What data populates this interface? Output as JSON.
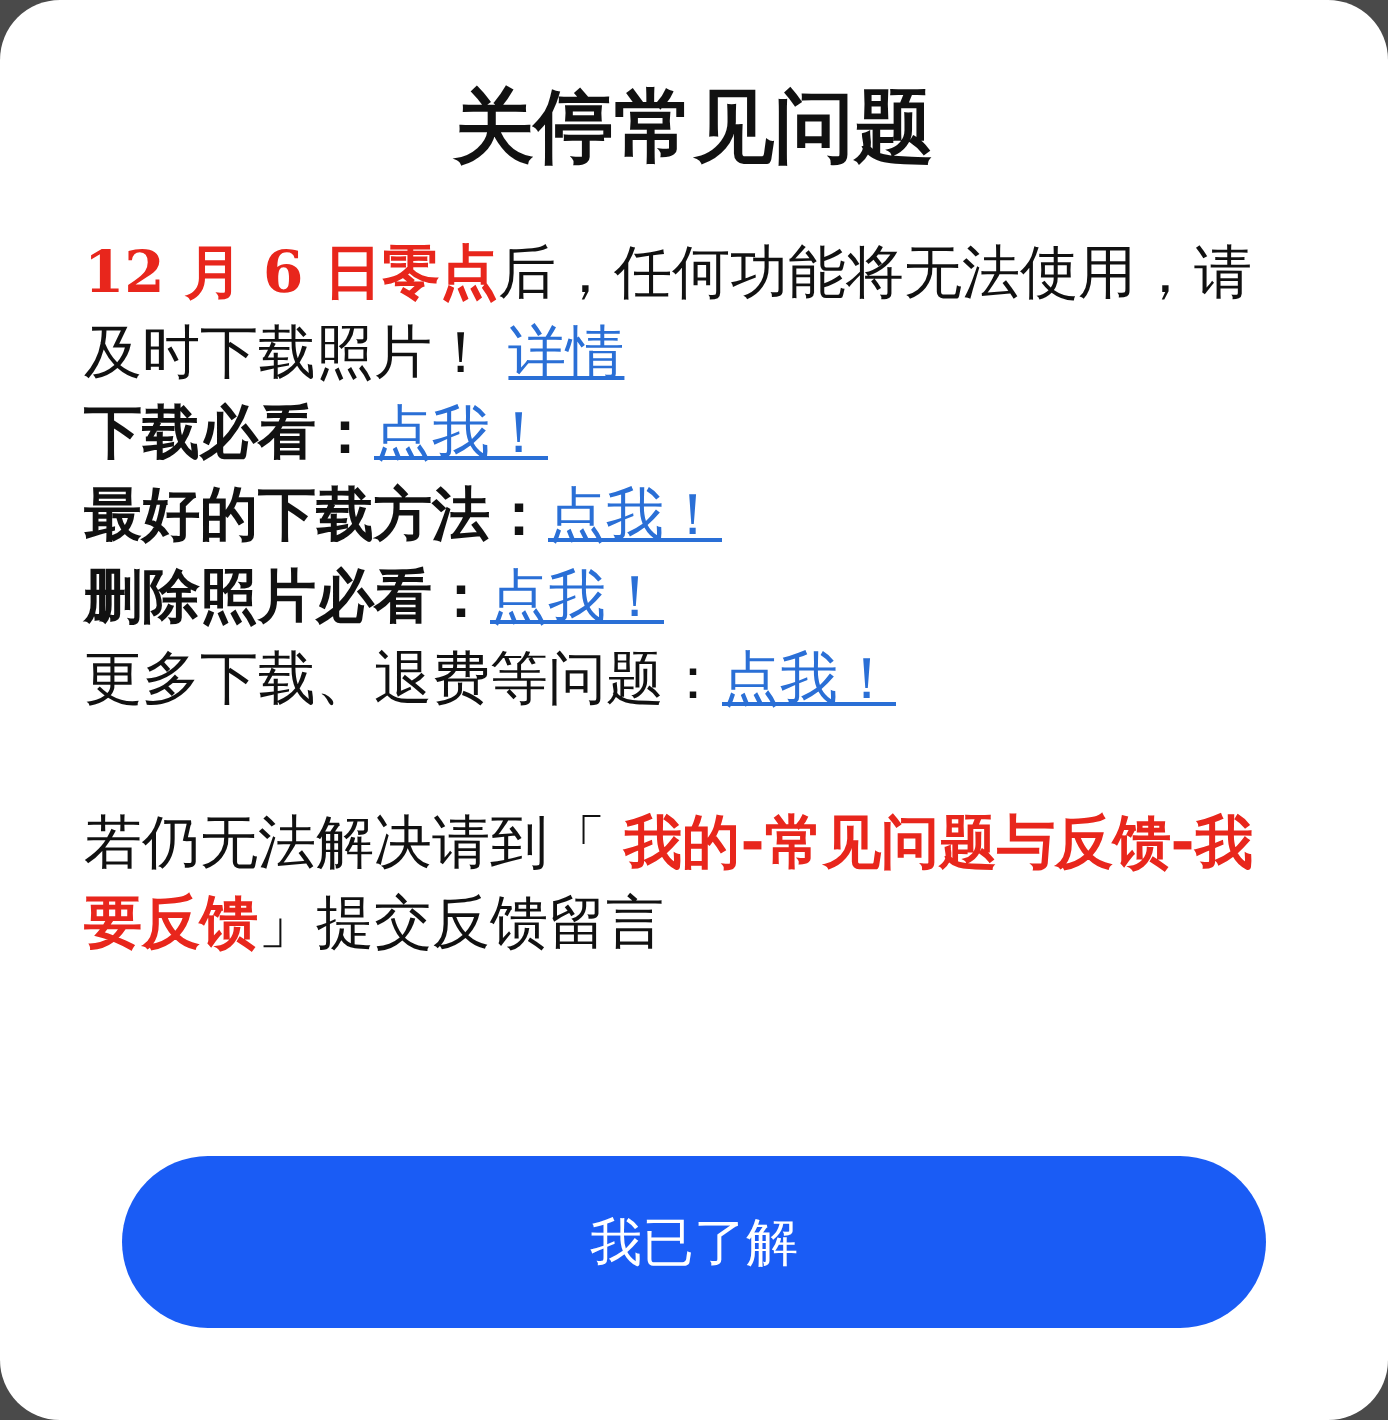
{
  "dialog": {
    "title": "关停常见问题",
    "notice": "**12 月 6 日零点**后，任何功能将无法使用，请及时下载照片！",
    "notice_link": "详情",
    "links": [
      {
        "label": "下载必看：",
        "bold": true,
        "link": "点我！"
      },
      {
        "label": "最好的下载方法：",
        "bold": true,
        "link": "点我！"
      },
      {
        "label": "删除照片必看：",
        "bold": true,
        "link": "点我！"
      },
      {
        "label": "更多下载、退费等问题：",
        "bold": false,
        "link": "点我！"
      }
    ],
    "help": "若仍无法解决请到「 **我的-常见问题与反馈-我要反馈**」提交反馈留言",
    "button": "我已了解"
  }
}
